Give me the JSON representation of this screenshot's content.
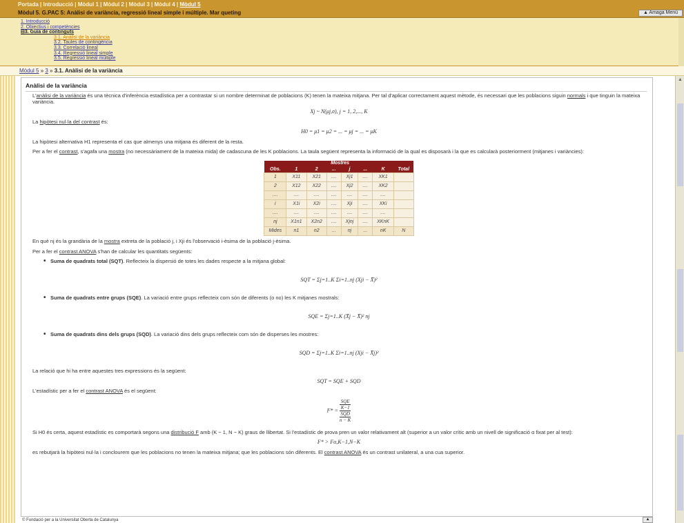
{
  "header": {
    "nav": [
      "Portada",
      "Introducció",
      "Mòdul 1",
      "Mòdul 2",
      "Mòdul 3",
      "Mòdul 4",
      "Mòdul 5"
    ],
    "module_title": "Mòdul 5. G.PAC 5: Anàlisi de variància, regressió lineal simple i múltiple. Mar queting",
    "hide_menu": "▲ Amaga Menú"
  },
  "toc": {
    "i1": "1. Introducció",
    "i2": "2. Objectius i competències",
    "i3": "⊟3. Guia de continguts",
    "s1": "3.1. Anàlisi de la variància",
    "s2": "3.2. Taules de contingència",
    "s3": "3.3. Correlació lineal",
    "s4": "3.4. Regressió lineal simple",
    "s5": "3.5. Regressió lineal múltiple"
  },
  "breadcrumb": {
    "a": "Mòdul 5",
    "sep1": " » ",
    "b": "3",
    "sep2": " » ",
    "cur": "3.1. Anàlisi de la variància"
  },
  "content": {
    "title": "Anàlisi de la variància",
    "p1a": "L'",
    "p1link": "anàlisi de la variància",
    "p1b": " és una tècnica d'inferència estadística per a contrastar si un nombre determinat de poblacions (K) tenen la mateixa mitjana. Per tal d'aplicar correctament aquest mètode, és necessari que les poblacions siguin ",
    "p1link2": "normals",
    "p1c": " i que tinguin la mateixa variància.",
    "f1": "Xj ~ N(μj,σ), j = 1, 2,..., K",
    "p2a": "La ",
    "p2link": "hipòtesi nul·la del contrast",
    "p2b": " és:",
    "f2": "H0 = μ1 = μ2 = ... = μj = ... = μK",
    "p3": "La hipòtesi alternativa H1 representa el cas que almenys una mitjana és diferent de la resta.",
    "p4a": "Per a fer el ",
    "p4link": "contrast",
    "p4b": ", s'agafa una ",
    "p4link2": "mostra",
    "p4c": " (no necessàriament de la mateixa mida) de cadascuna de les K poblacions. La taula següent representa la informació de la qual es disposarà i la que es calcularà posteriorment (mitjanes i variàncies):",
    "table": {
      "group_header": "Mostres",
      "headers": [
        "Obs.",
        "1",
        "2",
        "...",
        "j",
        "...",
        "K",
        "Total"
      ],
      "rows": [
        [
          "1",
          "X11",
          "X21",
          "....",
          "Xj1",
          "....",
          "XK1",
          ""
        ],
        [
          "2",
          "X12",
          "X22",
          "....",
          "Xj2",
          "....",
          "XK2",
          ""
        ],
        [
          "....",
          "....",
          "....",
          "....",
          "....",
          "....",
          "....",
          ""
        ],
        [
          "i",
          "X1i",
          "X2i",
          "....",
          "Xji",
          "....",
          "XKi",
          ""
        ],
        [
          "....",
          "....",
          "....",
          "....",
          "....",
          "....",
          "....",
          ""
        ],
        [
          "nj",
          "X1n1",
          "X2n2",
          "....",
          "Xjnj",
          "....",
          "XKnK",
          ""
        ]
      ],
      "mides": [
        "Mides",
        "n1",
        "n2",
        "...",
        "nj",
        "...",
        "nK",
        "N"
      ]
    },
    "p5a": "En què nj és la grandària de la ",
    "p5link": "mostra",
    "p5b": " extreta de la població j, i Xji és l'observació i-èsima de la població j-èsima.",
    "p6a": "Per a fer el ",
    "p6link": "contrast ANOVA",
    "p6b": " s'han de calcular les quantitats següents:",
    "b1t": "Suma de quadrats total (SQT)",
    "b1": ". Reflecteix la dispersió de totes les dades respecte a la mitjana global:",
    "fsqt": "SQT = Σj=1..K Σi=1..nj (Xji − X̄)²",
    "b2t": "Suma de quadrats entre grups (SQE)",
    "b2": ". La variació entre grups reflecteix com són de diferents (o no) les K mitjanes mostrals:",
    "fsqe": "SQE = Σj=1..K (X̄j − X̄)² nj",
    "b3t": "Suma de quadrats dins dels grups (SQD)",
    "b3": ". La variació dins dels grups reflecteix com són de disperses les mostres:",
    "fsqd": "SQD = Σj=1..K Σi=1..nj (Xji − X̄j)²",
    "p7": "La relació que hi ha entre aquestes tres expressions és la següent:",
    "f7": "SQT = SQE + SQD",
    "p8a": "L'estadístic per a fer el ",
    "p8link": "contrast ANOVA",
    "p8b": " és el següent:",
    "ff_lhs": "F* =",
    "ff_n1": "SQE",
    "ff_d1": "K−1",
    "ff_n2": "SQD",
    "ff_d2": "n − K",
    "p9a": "Si H0 és certa, aquest estadístic es comportarà segons una ",
    "p9link": "distribució F",
    "p9b": " amb (K − 1, N − K) graus de llibertat. Si l'estadístic de prova pren un valor relativament alt (superior a un valor crític amb un nivell de significació α fixat per al test):",
    "f9": "F* > Fα,K−1,N−K",
    "p10a": "es rebutjarà la hipòtesi nul·la i conclourem que les poblacions no tenen la mateixa mitjana; que les poblacions són diferents. El ",
    "p10link": "contrast ANOVA",
    "p10b": " és un contrast unilateral, a una cua superior."
  },
  "footer": "© Fundació per a la Universitat Oberta de Catalunya"
}
